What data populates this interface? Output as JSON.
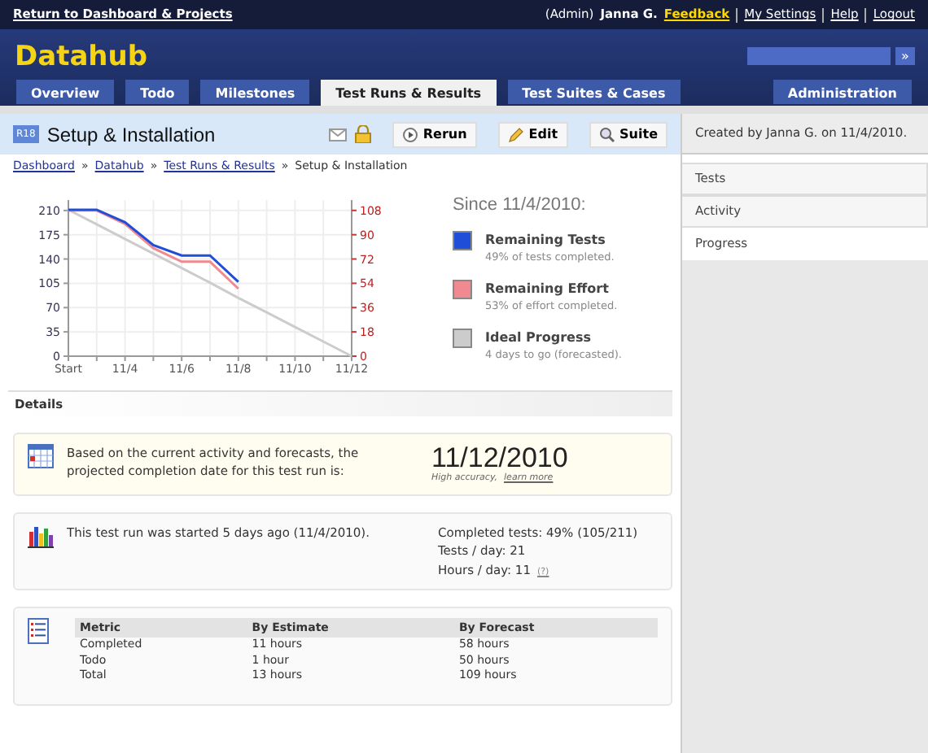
{
  "top_bar": {
    "return_link": "Return to Dashboard & Projects",
    "role": "(Admin)",
    "user": "Janna G.",
    "links": [
      {
        "label": "Feedback",
        "highlight": true
      },
      {
        "label": "My Settings",
        "highlight": false
      },
      {
        "label": "Help",
        "highlight": false
      },
      {
        "label": "Logout",
        "highlight": false
      }
    ]
  },
  "header": {
    "app_name": "Datahub",
    "search_button": "»"
  },
  "tabs": [
    {
      "label": "Overview",
      "selected": false
    },
    {
      "label": "Todo",
      "selected": false
    },
    {
      "label": "Milestones",
      "selected": false
    },
    {
      "label": "Test Runs & Results",
      "selected": true
    },
    {
      "label": "Test Suites & Cases",
      "selected": false
    }
  ],
  "admin_tab": {
    "label": "Administration",
    "selected": false
  },
  "page": {
    "badge": "R18",
    "title": "Setup & Installation",
    "buttons": [
      {
        "label": "Rerun",
        "kind": "rerun"
      },
      {
        "label": "Edit",
        "kind": "edit"
      },
      {
        "label": "Suite",
        "kind": "suite"
      }
    ]
  },
  "breadcrumb": [
    {
      "label": "Dashboard",
      "kind": "link"
    },
    {
      "label": "»",
      "kind": "separator"
    },
    {
      "label": "Datahub",
      "kind": "link"
    },
    {
      "label": "»",
      "kind": "separator"
    },
    {
      "label": "Test Runs & Results",
      "kind": "link"
    },
    {
      "label": "»",
      "kind": "separator"
    },
    {
      "label": "Setup & Installation",
      "kind": "text"
    }
  ],
  "chart_data": {
    "type": "line",
    "categories": [
      "Start",
      null,
      "11/4",
      null,
      "11/6",
      null,
      "11/8",
      null,
      "11/10",
      null,
      "11/12"
    ],
    "grid": true,
    "ylim": [
      0,
      225
    ],
    "yticks": [
      0,
      35,
      70,
      105,
      140,
      175,
      210
    ],
    "y2lim": [
      0,
      115.7
    ],
    "y2ticks": [
      0,
      18,
      36,
      54,
      72,
      90,
      108
    ],
    "series": [
      {
        "name": "Remaining Tests",
        "color": "#1f4fd8",
        "values": [
          211,
          211,
          193,
          160,
          145,
          145,
          107,
          null,
          null,
          null,
          null
        ]
      },
      {
        "name": "Remaining Effort",
        "color": "#f08a90",
        "axis": "y2",
        "values": [
          108,
          108,
          98,
          80,
          70,
          70,
          50,
          null,
          null,
          null,
          null
        ]
      },
      {
        "name": "Ideal Progress",
        "color": "#cccccc",
        "values": [
          211,
          190,
          169,
          148,
          127,
          106,
          84,
          63,
          42,
          21,
          0
        ]
      }
    ]
  },
  "legend": {
    "title": "Since 11/4/2010:",
    "notes": [
      "49% of tests completed.",
      "53% of effort completed.",
      "4 days to go (forecasted)."
    ]
  },
  "details": {
    "heading": "Details",
    "forecast": {
      "text": "Based on the current activity and forecasts, the projected completion date for this test run is:",
      "date": "11/12/2010",
      "accuracy": "High accuracy,",
      "learn_more": "learn more"
    },
    "activity": {
      "text": "This test run was started 5 days ago (11/4/2010).",
      "stats": [
        "Completed tests: 49% (105/211)",
        "Tests / day: 21"
      ],
      "hours": "Hours / day: 11",
      "help": "(?)"
    },
    "metrics": {
      "columns": [
        "Metric",
        "By Estimate",
        "By Forecast"
      ],
      "rows": [
        [
          "Completed",
          "11 hours",
          "58 hours"
        ],
        [
          "Todo",
          "1 hour",
          "50 hours"
        ],
        [
          "Total",
          "13 hours",
          "109 hours"
        ]
      ]
    }
  },
  "sidebar": {
    "created": "Created by Janna G. on 11/4/2010.",
    "items": [
      {
        "label": "Tests",
        "selected": false
      },
      {
        "label": "Activity",
        "selected": false
      },
      {
        "label": "Progress",
        "selected": true
      }
    ]
  }
}
